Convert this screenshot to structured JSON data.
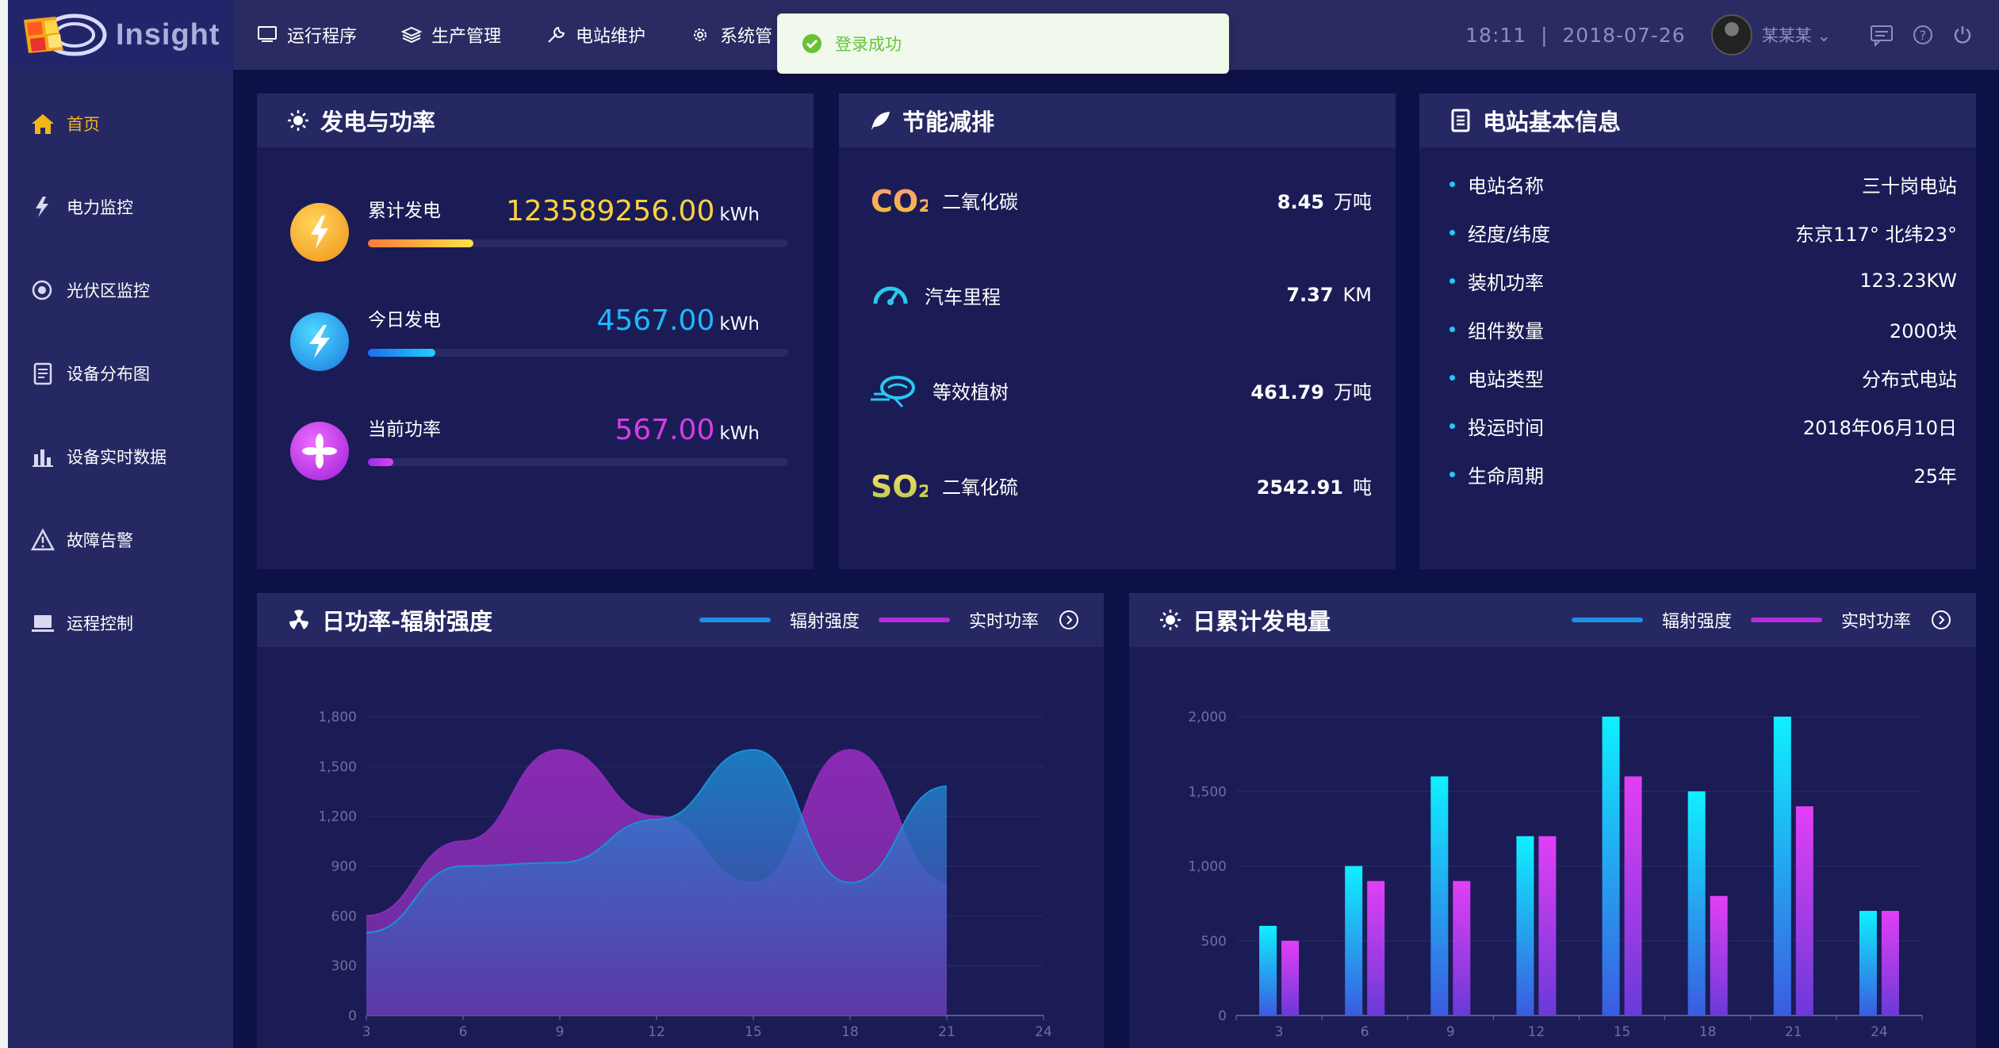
{
  "app": {
    "title": "Insight"
  },
  "topnav": [
    {
      "label": "运行程序",
      "icon": "monitor-icon"
    },
    {
      "label": "生产管理",
      "icon": "layers-icon"
    },
    {
      "label": "电站维护",
      "icon": "wrench-icon"
    },
    {
      "label": "系统管",
      "icon": "gear-icon"
    }
  ],
  "header": {
    "time": "18:11",
    "date": "2018-07-26",
    "user": "某某某"
  },
  "toast": {
    "text": "登录成功"
  },
  "sidebar": {
    "items": [
      {
        "label": "首页",
        "icon": "home-icon",
        "active": true
      },
      {
        "label": "电力监控",
        "icon": "lightning-icon"
      },
      {
        "label": "光伏区监控",
        "icon": "target-icon"
      },
      {
        "label": "设备分布图",
        "icon": "document-icon"
      },
      {
        "label": "设备实时数据",
        "icon": "bar-chart-icon"
      },
      {
        "label": "故障告警",
        "icon": "warning-icon"
      },
      {
        "label": "运程控制",
        "icon": "laptop-icon"
      }
    ]
  },
  "power_panel": {
    "title": "发电与功率",
    "rows": [
      {
        "label": "累计发电",
        "value": "123589256.00",
        "unit": "kWh",
        "color": "#ffd23f",
        "progress": 0.25
      },
      {
        "label": "今日发电",
        "value": "4567.00",
        "unit": "kWh",
        "color": "#1fb8ff",
        "progress": 0.16
      },
      {
        "label": "当前功率",
        "value": "567.00",
        "unit": "kWh",
        "color": "#d43ee8",
        "progress": 0.06
      }
    ]
  },
  "eco_panel": {
    "title": "节能减排",
    "rows": [
      {
        "label": "二氧化碳",
        "value": "8.45",
        "unit": "万吨",
        "icon": "co2-icon",
        "icon_text": "CO₂"
      },
      {
        "label": "汽车里程",
        "value": "7.37",
        "unit": "KM",
        "icon": "speedometer-icon"
      },
      {
        "label": "等效植树",
        "value": "461.79",
        "unit": "万吨",
        "icon": "tree-icon"
      },
      {
        "label": "二氧化硫",
        "value": "2542.91",
        "unit": "吨",
        "icon": "so2-icon",
        "icon_text": "SO₂"
      }
    ]
  },
  "station_panel": {
    "title": "电站基本信息",
    "rows": [
      {
        "label": "电站名称",
        "value": "三十岗电站"
      },
      {
        "label": "经度/纬度",
        "value": "东京117° 北纬23°"
      },
      {
        "label": "装机功率",
        "value": "123.23KW"
      },
      {
        "label": "组件数量",
        "value": "2000块"
      },
      {
        "label": "电站类型",
        "value": "分布式电站"
      },
      {
        "label": "投运时间",
        "value": "2018年06月10日"
      },
      {
        "label": "生命周期",
        "value": "25年"
      }
    ]
  },
  "chart_data": [
    {
      "type": "area",
      "title": "日功率-辐射强度",
      "x": [
        3,
        6,
        9,
        12,
        15,
        18,
        21
      ],
      "xlim": [
        3,
        24
      ],
      "xticks": [
        3,
        6,
        9,
        12,
        15,
        18,
        21,
        24
      ],
      "ylim": [
        0,
        1800
      ],
      "yticks": [
        0,
        300,
        600,
        900,
        1200,
        1500,
        1800
      ],
      "series": [
        {
          "name": "辐射强度",
          "values": [
            500,
            900,
            920,
            1180,
            1600,
            800,
            1380
          ],
          "color": "#1b8fd6"
        },
        {
          "name": "实时功率",
          "values": [
            600,
            1050,
            1600,
            1200,
            800,
            1600,
            800
          ],
          "color": "#8a2bb8"
        }
      ],
      "legend": "top-right"
    },
    {
      "type": "bar",
      "title": "日累计发电量",
      "categories": [
        3,
        6,
        9,
        12,
        15,
        18,
        21,
        24
      ],
      "ylim": [
        0,
        2000
      ],
      "yticks": [
        0,
        500,
        1000,
        1500,
        2000
      ],
      "series": [
        {
          "name": "辐射强度",
          "values": [
            600,
            1000,
            1600,
            1200,
            2000,
            1500,
            2000,
            700
          ],
          "color": "#12e5f5"
        },
        {
          "name": "实时功率",
          "values": [
            500,
            900,
            900,
            1200,
            1600,
            800,
            1400,
            700
          ],
          "color": "#d23ef2"
        }
      ],
      "legend": "top-right"
    }
  ]
}
